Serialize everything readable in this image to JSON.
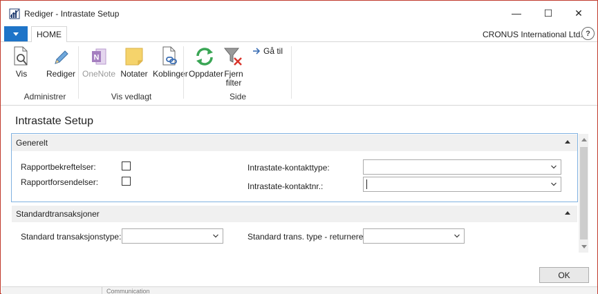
{
  "window": {
    "title": "Rediger - Intrastate Setup",
    "minimize_glyph": "—",
    "maximize_glyph": "☐",
    "close_glyph": "✕"
  },
  "ribbon": {
    "tab_home": "HOME",
    "company": "CRONUS International Ltd.",
    "help_glyph": "?",
    "buttons": {
      "vis": "Vis",
      "rediger": "Rediger",
      "onenote": "OneNote",
      "notater": "Notater",
      "koblinger": "Koblinger",
      "oppdater": "Oppdater",
      "fjern_filter_1": "Fjern",
      "fjern_filter_2": "filter",
      "ga_til": "Gå til"
    },
    "groups": {
      "administrer": "Administrer",
      "vis_vedlagt": "Vis vedlagt",
      "side": "Side"
    }
  },
  "page": {
    "title": "Intrastate Setup",
    "generelt": {
      "header": "Generelt",
      "rapportbekreftelser_label": "Rapportbekreftelser:",
      "rapportforsendelser_label": "Rapportforsendelser:",
      "kontakttype_label": "Intrastate-kontakttype:",
      "kontakttype_value": "",
      "kontaktnr_label": "Intrastate-kontaktnr.:",
      "kontaktnr_value": ""
    },
    "standardtransaksjoner": {
      "header": "Standardtransaksjoner",
      "transaksjonstype_label": "Standard transaksjonstype:",
      "transaksjonstype_value": "",
      "returnerer_label": "Standard trans. type - returnerer:",
      "returnerer_value": ""
    },
    "ok_label": "OK",
    "background_text": "Communication"
  },
  "colors": {
    "accent": "#1e74c8",
    "frame_border": "#c0392b",
    "fasttab_border": "#7fb1e0",
    "refresh_green": "#3aa655",
    "onenote_purple": "#a57fc0",
    "note_yellow": "#f5d36b",
    "filter_red": "#d9342b"
  }
}
